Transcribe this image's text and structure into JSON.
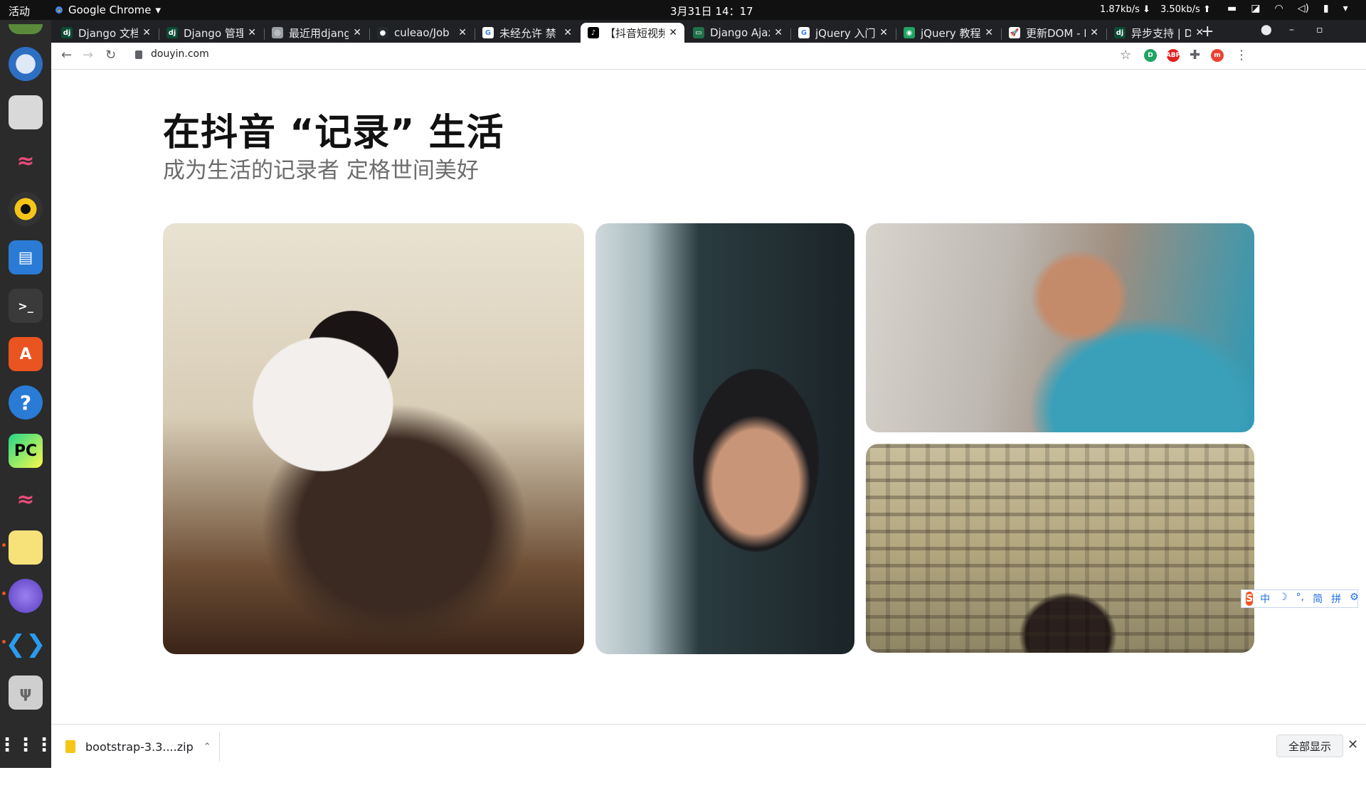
{
  "system_bar": {
    "activities": "活动",
    "app_name": "Google Chrome",
    "clock": "3月31日 14：17",
    "download_speed": "1.87kb/s",
    "upload_speed": "3.50kb/s"
  },
  "tabs": [
    {
      "title": "Django 文档",
      "favicon": "dj"
    },
    {
      "title": "Django 管理",
      "favicon": "dj"
    },
    {
      "title": "最近用django",
      "favicon": "◎"
    },
    {
      "title": "culeao/Job",
      "favicon": "●"
    },
    {
      "title": "未经允许 禁",
      "favicon": "G"
    },
    {
      "title": "【抖音短视频",
      "favicon": "♪",
      "active": true
    },
    {
      "title": "Django Ajax",
      "favicon": "▭"
    },
    {
      "title": "jQuery 入门",
      "favicon": "G"
    },
    {
      "title": "jQuery 教程",
      "favicon": "◉"
    },
    {
      "title": "更新DOM - I",
      "favicon": "🚀"
    },
    {
      "title": "异步支持 | D",
      "favicon": "dj"
    }
  ],
  "omnibox": {
    "url": "douyin.com"
  },
  "page": {
    "headline": "在抖音 “记录” 生活",
    "subline": "成为生活的记录者 定格世间美好"
  },
  "ime_bar": {
    "items": [
      "中",
      "☽",
      "°,",
      "简",
      "拼",
      "⚙"
    ]
  },
  "download_bar": {
    "filename": "bootstrap-3.3....zip",
    "show_all": "全部显示"
  },
  "colors": {
    "accent": "#e95420",
    "chrome_dark": "#202124",
    "dock_bg": "#2b2b2b"
  }
}
